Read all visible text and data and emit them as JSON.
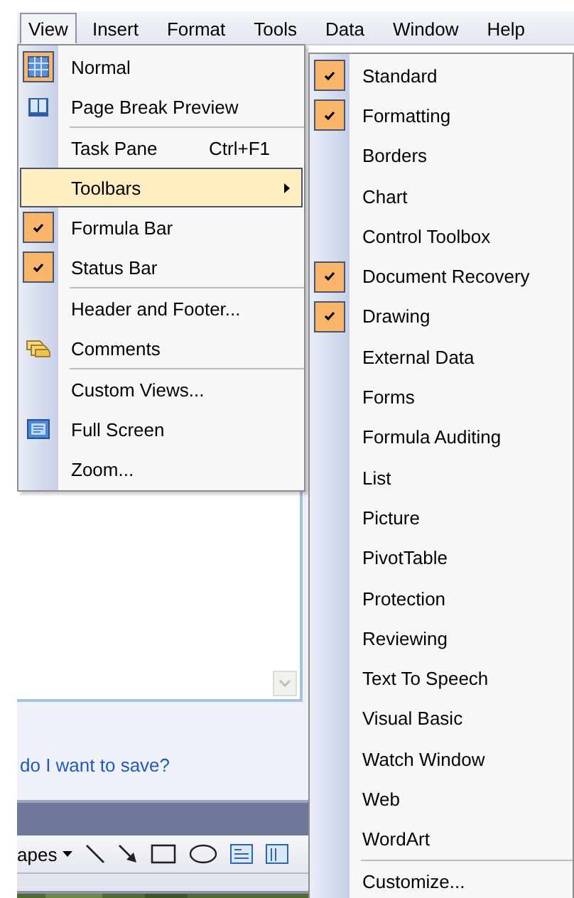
{
  "menu_bar": [
    {
      "label": "View",
      "selected": true
    },
    {
      "label": "Insert",
      "selected": false
    },
    {
      "label": "Format",
      "selected": false
    },
    {
      "label": "Tools",
      "selected": false
    },
    {
      "label": "Data",
      "selected": false
    },
    {
      "label": "Window",
      "selected": false
    },
    {
      "label": "Help",
      "selected": false
    }
  ],
  "view_menu": {
    "groups": [
      {
        "items": [
          {
            "label": "Normal",
            "checked": true,
            "highlighted": false
          },
          {
            "label": "Page Break Preview",
            "checked": false,
            "highlighted": false
          }
        ]
      },
      {
        "items": [
          {
            "label": "Task Pane",
            "shortcut": "Ctrl+F1",
            "checked": false,
            "highlighted": false
          },
          {
            "label": "Toolbars",
            "submenu": true,
            "checked": false,
            "highlighted": true
          },
          {
            "label": "Formula Bar",
            "checked": true,
            "highlighted": false
          },
          {
            "label": "Status Bar",
            "checked": true,
            "highlighted": false
          }
        ]
      },
      {
        "items": [
          {
            "label": "Header and Footer...",
            "checked": false,
            "highlighted": false
          },
          {
            "label": "Comments",
            "checked": false,
            "highlighted": false
          }
        ]
      },
      {
        "items": [
          {
            "label": "Custom Views...",
            "checked": false,
            "highlighted": false
          },
          {
            "label": "Full Screen",
            "checked": false,
            "highlighted": false
          },
          {
            "label": "Zoom...",
            "checked": false,
            "highlighted": false
          }
        ]
      }
    ]
  },
  "toolbars_menu": {
    "groups": [
      {
        "items": [
          {
            "label": "Standard",
            "checked": true,
            "highlighted": false
          },
          {
            "label": "Formatting",
            "checked": true,
            "highlighted": false
          },
          {
            "label": "Borders",
            "checked": false,
            "highlighted": false
          },
          {
            "label": "Chart",
            "checked": false,
            "highlighted": false
          },
          {
            "label": "Control Toolbox",
            "checked": false,
            "highlighted": false
          },
          {
            "label": "Document Recovery",
            "checked": true,
            "highlighted": false
          },
          {
            "label": "Drawing",
            "checked": true,
            "highlighted": false
          },
          {
            "label": "External Data",
            "checked": false,
            "highlighted": false
          },
          {
            "label": "Forms",
            "checked": false,
            "highlighted": false
          },
          {
            "label": "Formula Auditing",
            "checked": false,
            "highlighted": false
          },
          {
            "label": "List",
            "checked": false,
            "highlighted": false
          },
          {
            "label": "Picture",
            "checked": false,
            "highlighted": false
          },
          {
            "label": "PivotTable",
            "checked": false,
            "highlighted": false
          },
          {
            "label": "Protection",
            "checked": false,
            "highlighted": false
          },
          {
            "label": "Reviewing",
            "checked": false,
            "highlighted": false
          },
          {
            "label": "Text To Speech",
            "checked": false,
            "highlighted": false
          },
          {
            "label": "Visual Basic",
            "checked": false,
            "highlighted": false
          },
          {
            "label": "Watch Window",
            "checked": false,
            "highlighted": false
          },
          {
            "label": "Web",
            "checked": false,
            "highlighted": false
          },
          {
            "label": "WordArt",
            "checked": false,
            "highlighted": false
          }
        ]
      },
      {
        "items": [
          {
            "label": "Customize...",
            "checked": false,
            "highlighted": false
          }
        ]
      }
    ]
  },
  "task_pane": {
    "link": "do I want to save?"
  },
  "drawing_toolbar": {
    "shapes_label": "apes"
  }
}
